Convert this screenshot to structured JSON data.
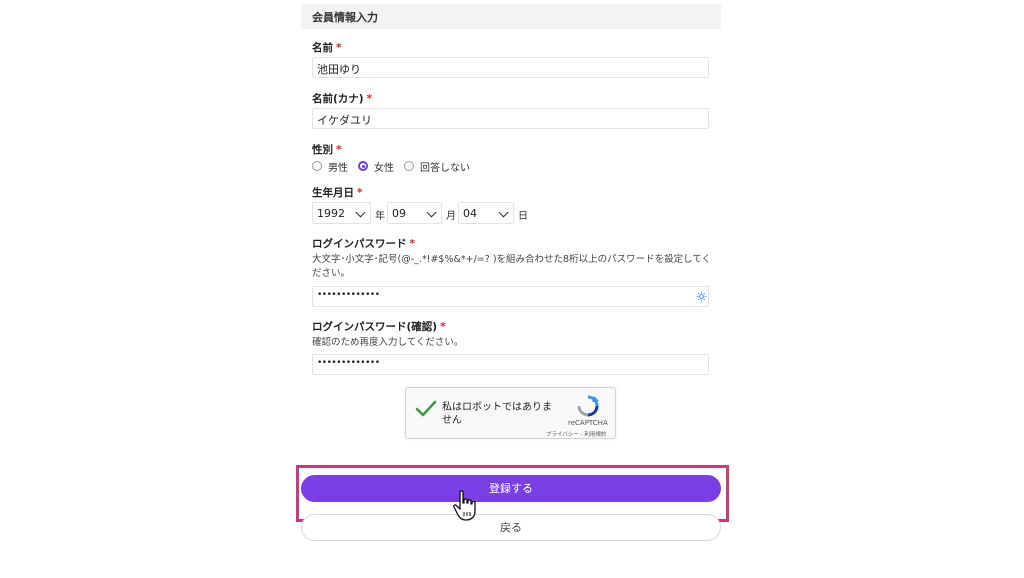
{
  "section": {
    "title": "会員情報入力"
  },
  "name": {
    "label": "名前",
    "required": "*",
    "value": "池田ゆり"
  },
  "name_kana": {
    "label": "名前(カナ)",
    "required": "*",
    "value": "イケダユリ"
  },
  "gender": {
    "label": "性別",
    "required": "*",
    "options": [
      "男性",
      "女性",
      "回答しない"
    ],
    "selected": "女性"
  },
  "birthdate": {
    "label": "生年月日",
    "required": "*",
    "year": "1992",
    "year_unit": "年",
    "month": "09",
    "month_unit": "月",
    "day": "04",
    "day_unit": "日"
  },
  "password": {
    "label": "ログインパスワード",
    "required": "*",
    "help": "大文字･小文字･記号(@-_.*!#$%&*+/=? )を組み合わせた8桁以上のパスワードを設定してください。",
    "value": "•••••••••••••"
  },
  "password_confirm": {
    "label": "ログインパスワード(確認)",
    "required": "*",
    "help": "確認のため再度入力してください。",
    "value": "•••••••••••••"
  },
  "captcha": {
    "text": "私はロボットではありません",
    "brand": "reCAPTCHA",
    "links": "プライバシー - 利用規約",
    "checked": true
  },
  "actions": {
    "submit": "登録する",
    "back": "戻る"
  },
  "colors": {
    "accent": "#7a3fe4",
    "required": "#d2263c",
    "highlight": "#c0407a",
    "check": "#3a9a4a"
  }
}
